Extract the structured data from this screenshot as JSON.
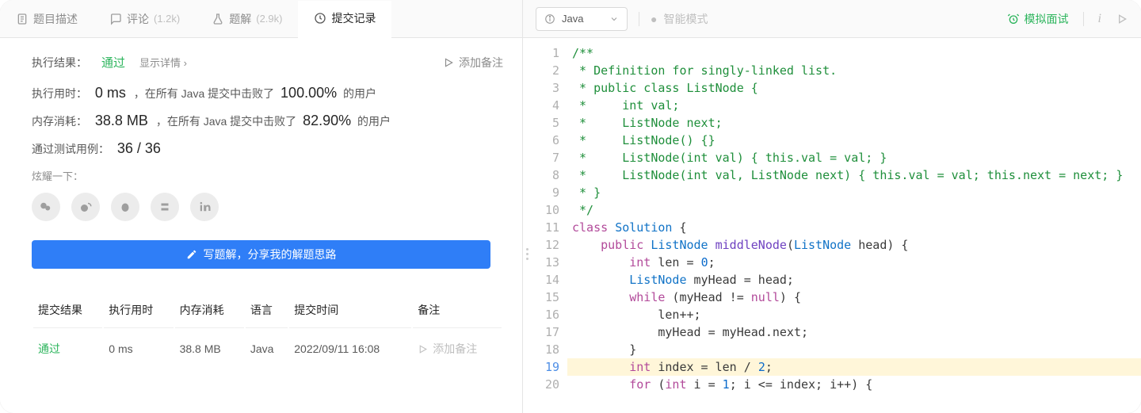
{
  "tabs": {
    "desc": "题目描述",
    "comments": "评论",
    "comments_count": "(1.2k)",
    "solutions": "题解",
    "solutions_count": "(2.9k)",
    "submissions": "提交记录"
  },
  "result": {
    "label": "执行结果：",
    "status": "通过",
    "show_detail": "显示详情",
    "add_note": "添加备注"
  },
  "metrics": {
    "time_label": "执行用时：",
    "time_val": "0 ms",
    "time_tail_a": "，在所有 Java 提交中击败了",
    "time_pct": "100.00%",
    "time_tail_b": "的用户",
    "mem_label": "内存消耗：",
    "mem_val": "38.8 MB",
    "mem_tail_a": "，在所有 Java 提交中击败了",
    "mem_pct": "82.90%",
    "mem_tail_b": "的用户",
    "cases_label": "通过测试用例：",
    "cases_val": "36 / 36"
  },
  "share": {
    "label": "炫耀一下："
  },
  "write_solution": "写题解，分享我的解题思路",
  "table": {
    "headers": {
      "result": "提交结果",
      "time": "执行用时",
      "mem": "内存消耗",
      "lang": "语言",
      "when": "提交时间",
      "note": "备注"
    },
    "rows": [
      {
        "result": "通过",
        "time": "0 ms",
        "mem": "38.8 MB",
        "lang": "Java",
        "when": "2022/09/11 16:08",
        "note": "添加备注"
      }
    ]
  },
  "toolbar": {
    "lang": "Java",
    "smart": "智能模式",
    "mock": "模拟面试"
  },
  "code": {
    "lines": [
      "/**",
      " * Definition for singly-linked list.",
      " * public class ListNode {",
      " *     int val;",
      " *     ListNode next;",
      " *     ListNode() {}",
      " *     ListNode(int val) { this.val = val; }",
      " *     ListNode(int val, ListNode next) { this.val = val; this.next = next; }",
      " * }",
      " */",
      "class Solution {",
      "    public ListNode middleNode(ListNode head) {",
      "        int len = 0;",
      "        ListNode myHead = head;",
      "        while (myHead != null) {",
      "            len++;",
      "            myHead = myHead.next;",
      "        }",
      "        int index = len / 2;",
      "        for (int i = 1; i <= index; i++) {"
    ],
    "highlight_line": 19
  }
}
